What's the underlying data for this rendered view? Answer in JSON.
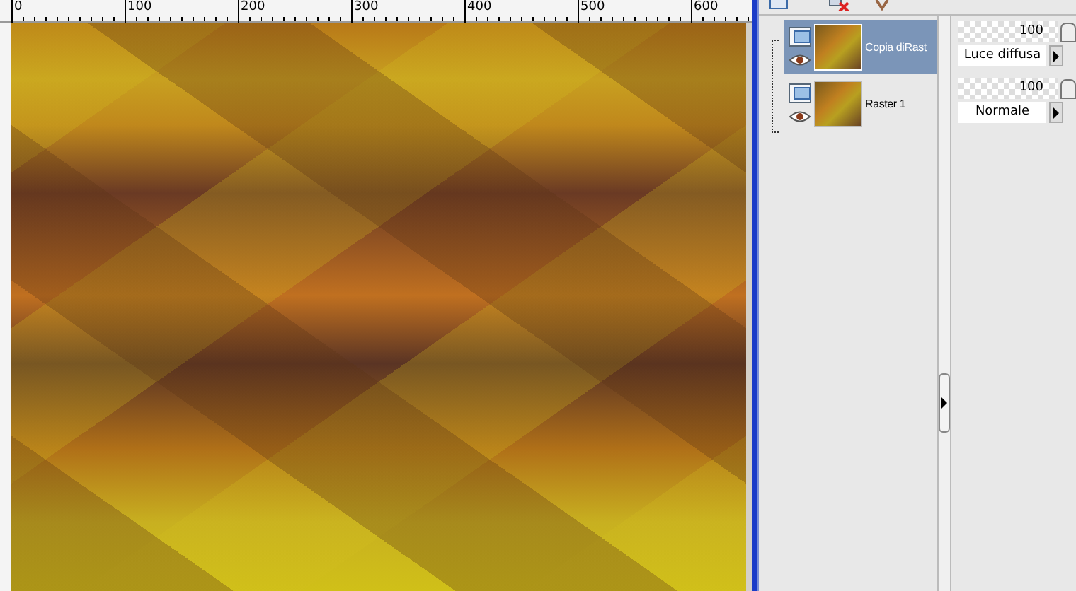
{
  "ruler": {
    "labels": [
      "0",
      "100",
      "200",
      "300",
      "400",
      "500",
      "600"
    ]
  },
  "layers": [
    {
      "name": "Copia diRast",
      "selected": true,
      "visible": true,
      "opacity": "100",
      "blend": "Luce diffusa"
    },
    {
      "name": "Raster 1",
      "selected": false,
      "visible": true,
      "opacity": "100",
      "blend": "Normale"
    }
  ]
}
